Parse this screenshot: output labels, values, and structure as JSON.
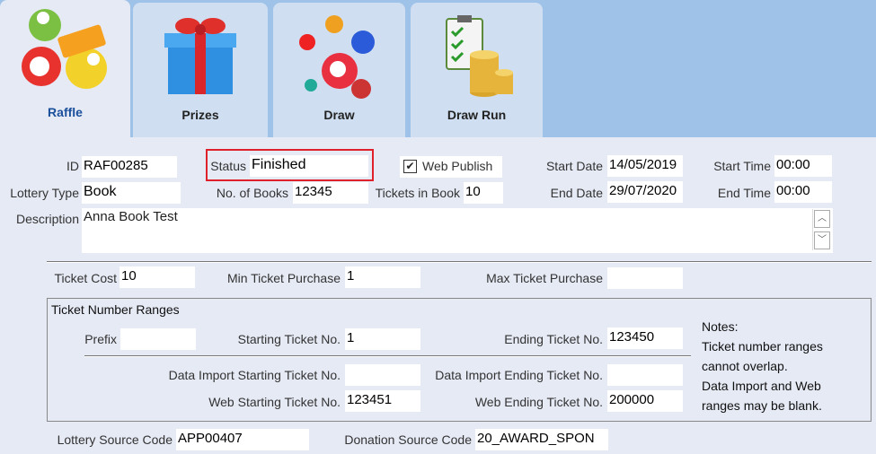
{
  "tabs": [
    {
      "label": "Raffle",
      "icon": "raffle-balls-icon"
    },
    {
      "label": "Prizes",
      "icon": "gift-box-icon"
    },
    {
      "label": "Draw",
      "icon": "lottery-balls-icon"
    },
    {
      "label": "Draw Run",
      "icon": "checklist-coins-icon"
    }
  ],
  "form": {
    "id_label": "ID",
    "id_value": "RAF00285",
    "status_label": "Status",
    "status_value": "Finished",
    "web_publish_label": "Web Publish",
    "web_publish_checked": true,
    "start_date_label": "Start Date",
    "start_date_value": "14/05/2019",
    "start_time_label": "Start Time",
    "start_time_value": "00:00",
    "lottery_type_label": "Lottery Type",
    "lottery_type_value": "Book",
    "no_books_label": "No. of Books",
    "no_books_value": "12345",
    "tickets_in_book_label": "Tickets in Book",
    "tickets_in_book_value": "10",
    "end_date_label": "End Date",
    "end_date_value": "29/07/2020",
    "end_time_label": "End Time",
    "end_time_value": "00:00",
    "description_label": "Description",
    "description_value": "Anna Book Test"
  },
  "ticket": {
    "cost_label": "Ticket Cost",
    "cost_value": "10",
    "min_label": "Min Ticket Purchase",
    "min_value": "1",
    "max_label": "Max Ticket Purchase",
    "max_value": ""
  },
  "ranges": {
    "title": "Ticket Number Ranges",
    "prefix_label": "Prefix",
    "prefix_value": "",
    "start_label": "Starting Ticket No.",
    "start_value": "1",
    "end_label": "Ending Ticket No.",
    "end_value": "123450",
    "di_start_label": "Data Import Starting Ticket No.",
    "di_start_value": "",
    "di_end_label": "Data Import Ending Ticket No.",
    "di_end_value": "",
    "web_start_label": "Web Starting Ticket No.",
    "web_start_value": "123451",
    "web_end_label": "Web Ending Ticket No.",
    "web_end_value": "200000",
    "notes": [
      "Notes:",
      "Ticket number ranges",
      "cannot overlap.",
      "Data Import and Web",
      "ranges may be blank."
    ]
  },
  "source": {
    "lottery_label": "Lottery Source Code",
    "lottery_value": "APP00407",
    "donation_label": "Donation Source Code",
    "donation_value": "20_AWARD_SPON"
  },
  "colors": {
    "status_highlight": "#e0202a",
    "tab_bar": "#9ec2e8",
    "active_tab_label": "#1a4f9c"
  }
}
